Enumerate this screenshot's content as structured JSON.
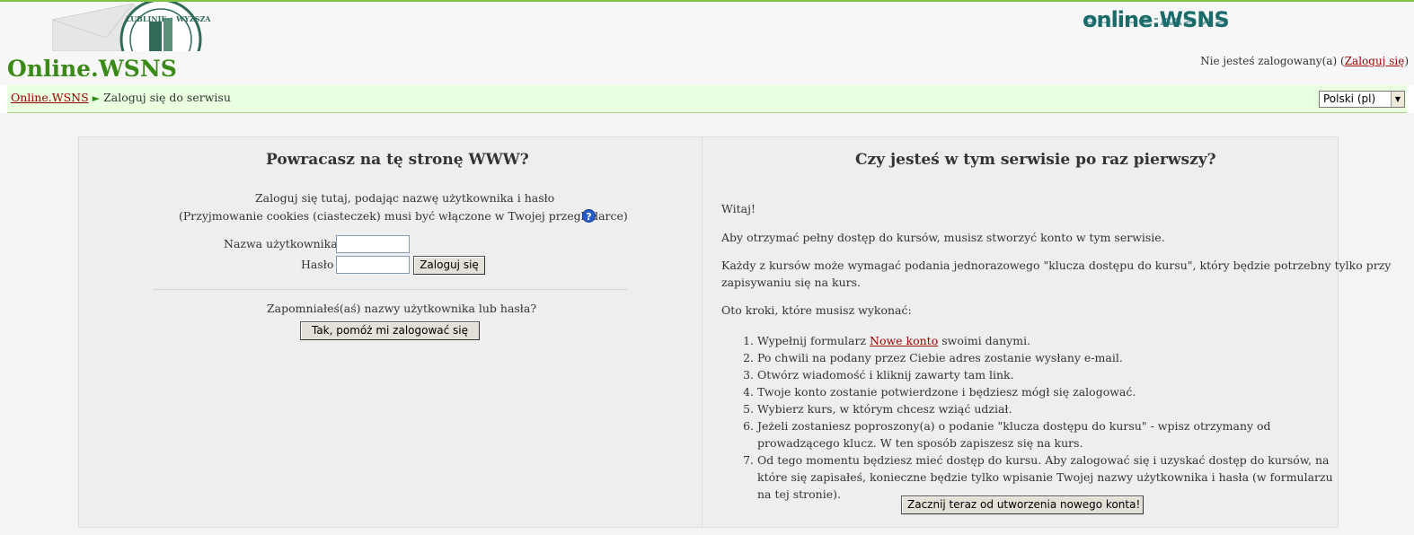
{
  "header": {
    "site_title": "Online.WSNS",
    "logo_text": "online.WSNS",
    "seal_text": "LUBLINIE • WYŻSZA SZKO",
    "login_info_prefix": "Nie jesteś zalogowany(a) (",
    "login_link": "Zaloguj się",
    "login_info_suffix": ")"
  },
  "navbar": {
    "breadcrumb_home": "Online.WSNS",
    "breadcrumb_sep": "►",
    "breadcrumb_current": "Zaloguj się do serwisu",
    "language": "Polski (pl)"
  },
  "left": {
    "heading": "Powracasz na tę stronę WWW?",
    "intro_line1": "Zaloguj się tutaj, podając nazwę użytkownika i hasło",
    "intro_line2": "(Przyjmowanie cookies (ciasteczek) musi być włączone w Twojej przeglądarce)",
    "username_label": "Nazwa użytkownika",
    "username_value": "",
    "password_label": "Hasło",
    "password_value": "",
    "login_button": "Zaloguj się",
    "forgot_text": "Zapomniałeś(aś) nazwy użytkownika lub hasła?",
    "forgot_button": "Tak, pomóż mi zalogować się"
  },
  "right": {
    "heading": "Czy jesteś w tym serwisie po raz pierwszy?",
    "greeting": "Witaj!",
    "para1": "Aby otrzymać pełny dostęp do kursów, musisz stworzyć konto w tym serwisie.",
    "para2_line1": "Każdy z kursów może wymagać podania jednorazowego \"klucza dostępu do kursu\", który będzie potrzebny tylko przy",
    "para2_line2": "zapisywaniu się na kurs.",
    "steps_intro": "Oto kroki, które musisz wykonać:",
    "step1_prefix": "Wypełnij formularz ",
    "step1_link": "Nowe konto",
    "step1_suffix": " swoimi danymi.",
    "steps": [
      "Po chwili na podany przez Ciebie adres zostanie wysłany e-mail.",
      "Otwórz wiadomość i kliknij zawarty tam link.",
      "Twoje konto zostanie potwierdzone i będziesz mógł się zalogować.",
      "Wybierz kurs, w którym chcesz wziąć udział.",
      "Jeżeli zostaniesz poproszony(a) o podanie \"klucza dostępu do kursu\" - wpisz otrzymany od prowadzącego klucz. W ten sposób zapiszesz się na kurs.",
      "Od tego momentu będziesz mieć dostęp do kursu. Aby zalogować się i uzyskać dostęp do kursów, na które się zapisałeś, konieczne będzie tylko wpisanie Twojej nazwy użytkownika i hasła (w formularzu na tej stronie)."
    ],
    "signup_button": "Zacznij teraz od utworzenia nowego konta!"
  },
  "colors": {
    "title_green": "#3a8a17",
    "navbar_bg": "#eaffe0",
    "link_red": "#990000",
    "logo_teal": "#1b6b6b"
  },
  "icons": {
    "help": "help-icon",
    "language_dropdown": "chevron-down-icon"
  }
}
